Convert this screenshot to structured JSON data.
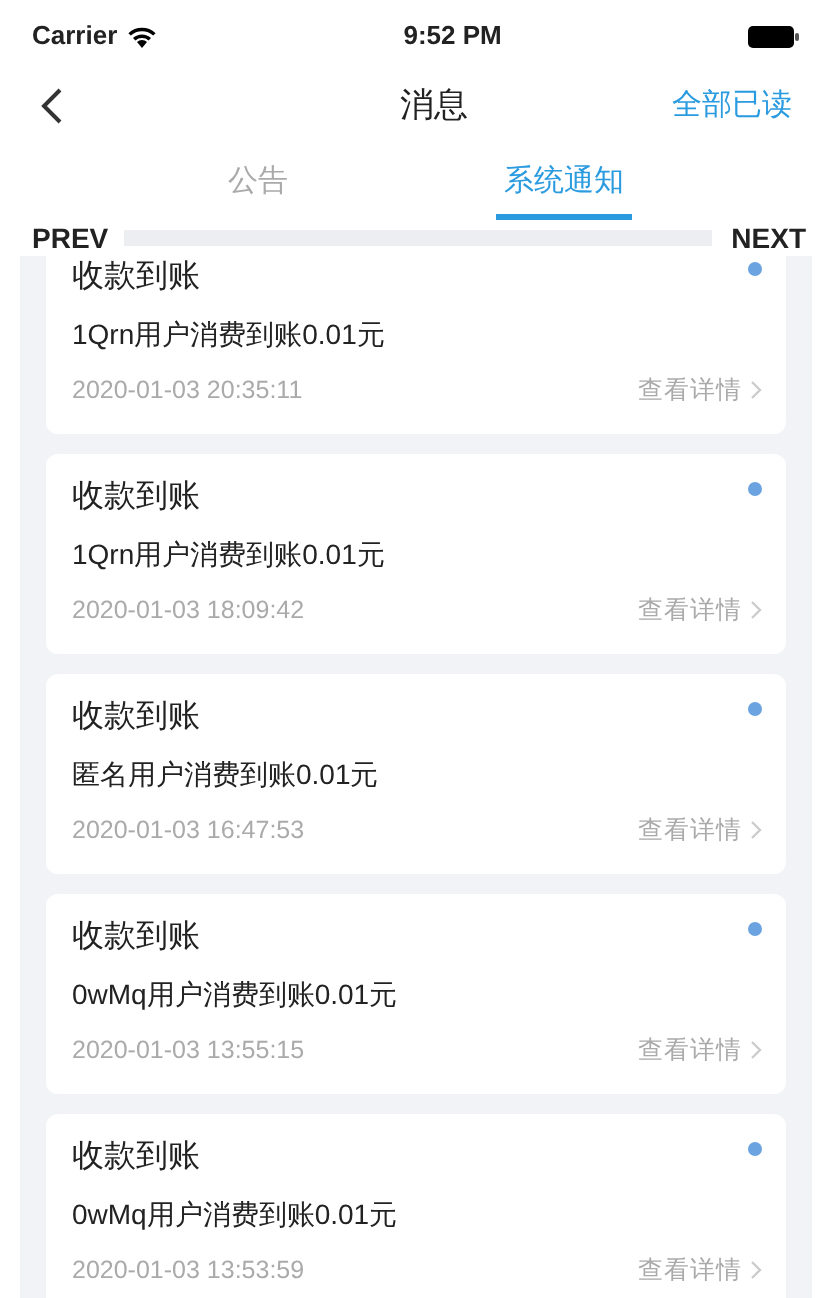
{
  "status_bar": {
    "carrier": "Carrier",
    "time": "9:52 PM"
  },
  "nav": {
    "title": "消息",
    "action": "全部已读"
  },
  "tabs": [
    {
      "label": "公告",
      "selected": false
    },
    {
      "label": "系统通知",
      "selected": true
    }
  ],
  "pager": {
    "prev": "PREV",
    "next": "NEXT"
  },
  "messages": [
    {
      "title": "收款到账",
      "body": "1Qrn用户消费到账0.01元",
      "time": "2020-01-03 20:35:11",
      "link": "查看详情",
      "unread": true
    },
    {
      "title": "收款到账",
      "body": "1Qrn用户消费到账0.01元",
      "time": "2020-01-03 18:09:42",
      "link": "查看详情",
      "unread": true
    },
    {
      "title": "收款到账",
      "body": "匿名用户消费到账0.01元",
      "time": "2020-01-03 16:47:53",
      "link": "查看详情",
      "unread": true
    },
    {
      "title": "收款到账",
      "body": "0wMq用户消费到账0.01元",
      "time": "2020-01-03 13:55:15",
      "link": "查看详情",
      "unread": true
    },
    {
      "title": "收款到账",
      "body": "0wMq用户消费到账0.01元",
      "time": "2020-01-03 13:53:59",
      "link": "查看详情",
      "unread": true
    }
  ]
}
